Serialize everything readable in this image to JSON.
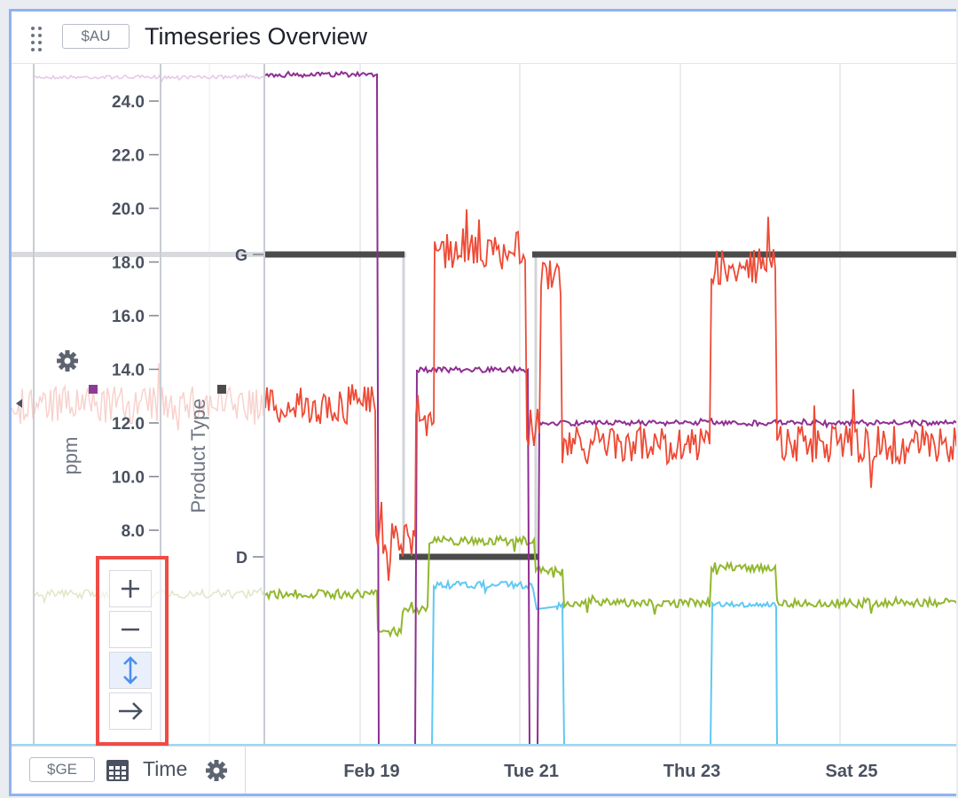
{
  "header": {
    "asset_tag": "$AU",
    "title": "Timeseries Overview"
  },
  "footer": {
    "time_tag": "$GE",
    "time_label": "Time"
  },
  "axes": {
    "ppm_label": "ppm",
    "ppm_color": "#8e3b97",
    "product_label": "Product Type",
    "product_levels": [
      "G",
      "D"
    ],
    "y_ticks": [
      "24.0",
      "22.0",
      "20.0",
      "18.0",
      "16.0",
      "14.0",
      "12.0",
      "10.0",
      "8.0"
    ],
    "x_ticks": [
      "Feb 19",
      "Tue 21",
      "Thu 23",
      "Sat 25"
    ]
  },
  "zoom_controls": {
    "icons": [
      "plus-icon",
      "minus-icon",
      "vertical-arrows-icon",
      "right-arrow-icon"
    ]
  },
  "colors": {
    "accent": "#4a8ff0",
    "highlight": "#f04b45",
    "series_red": "#ee4a35",
    "series_purple": "#8e2f92",
    "series_green": "#92b72f",
    "series_cyan": "#5fc9f3",
    "product_type": "#4b4b4b"
  }
}
